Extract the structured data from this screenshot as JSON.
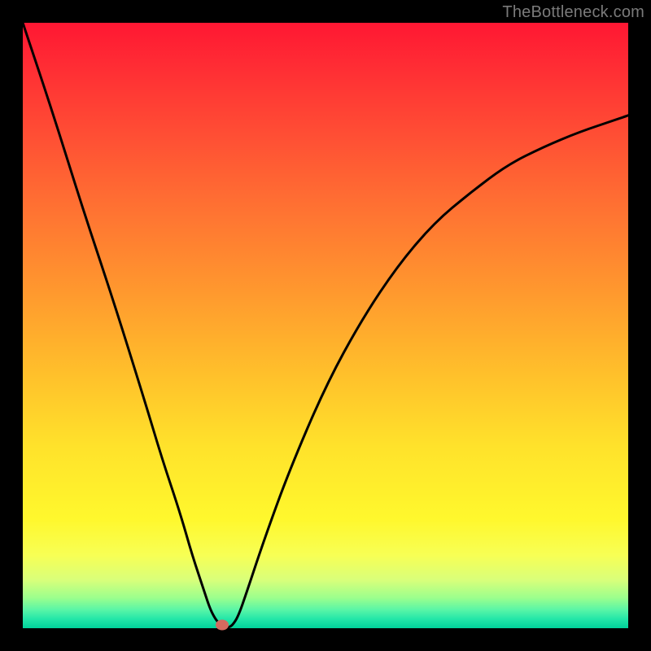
{
  "watermark": "TheBottleneck.com",
  "colors": {
    "gradient_top": "#ff1733",
    "gradient_bottom": "#00d29a",
    "curve": "#000000",
    "marker": "#d46a5f",
    "frame_bg": "#000000"
  },
  "chart_data": {
    "type": "line",
    "title": "",
    "xlabel": "",
    "ylabel": "",
    "xlim": [
      0,
      100
    ],
    "ylim": [
      0,
      100
    ],
    "grid": false,
    "legend": false,
    "series": [
      {
        "name": "bottleneck-curve",
        "x": [
          0,
          5,
          10,
          15,
          20,
          23,
          26,
          28,
          30,
          31,
          32,
          32.9,
          33.8,
          34.6,
          35.6,
          37,
          40,
          44,
          50,
          56,
          62,
          68,
          74,
          80,
          86,
          92,
          98,
          100
        ],
        "values": [
          100,
          85,
          69,
          54,
          38,
          28,
          19,
          12,
          6,
          3,
          1.2,
          0.4,
          0.1,
          0.4,
          2.0,
          6,
          15,
          26,
          40,
          51,
          60,
          67,
          72,
          76.5,
          79.5,
          82,
          84,
          84.7
        ]
      }
    ],
    "annotations": [
      {
        "name": "minimum-marker",
        "x": 32.9,
        "y": 0.6
      }
    ]
  }
}
